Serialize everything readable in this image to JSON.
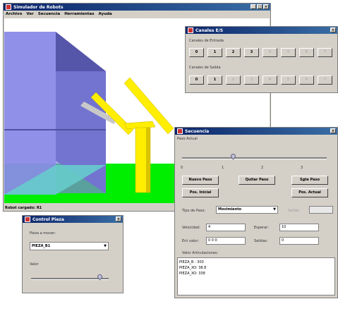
{
  "main_window": {
    "title": "Simulador de Robots",
    "menu": [
      "Archivo",
      "Ver",
      "Secuencia",
      "Herramientas",
      "Ayuda"
    ],
    "status": "Robot cargado: R1",
    "title_buttons": [
      "_",
      "□",
      "×"
    ]
  },
  "canales": {
    "title": "Canales E/S",
    "input_label": "Canales de Entrada",
    "output_label": "Canales de Salida",
    "input_buttons": [
      "0",
      "1",
      "2",
      "3",
      "4",
      "5",
      "6",
      "7"
    ],
    "input_enabled_count": 4,
    "output_buttons": [
      "0",
      "1",
      "2",
      "3",
      "4",
      "5",
      "6",
      "7"
    ],
    "output_enabled_count": 2
  },
  "secuencia": {
    "title": "Secuencia",
    "step_label": "Paso Actual",
    "slider_ticks": [
      "0",
      "1",
      "2",
      "3"
    ],
    "slider_value": 0.35,
    "buttons": {
      "new_step": "Nuevo Paso",
      "delete_step": "Quitar Paso",
      "next_step": "Sgte Paso",
      "initial_pos": "Pos. Inicial",
      "current_pos": "Pos. Actual"
    },
    "type_label": "Tipo de Paso:",
    "type_value": "Movimiento",
    "salida_label": "Salida:",
    "salida_value": "",
    "velocidad_label": "Velocidad:",
    "velocidad_value": "4",
    "espera_label": "Esperar:",
    "espera_value": "10",
    "entrada_label": "Ent valor:",
    "entrada_value": "0 0 0",
    "salidas_label": "Salidas:",
    "salidas_value": "0",
    "list_label": "Valor Articulaciones:",
    "list_items": [
      "PIEZA_B : 303",
      "PIEZA_XO: 38.8",
      "PIEZA_XO: 338"
    ]
  },
  "control": {
    "title": "Control Pieza",
    "pieza_label": "Pieza a mover:",
    "pieza_value": "PIEZA_B1",
    "valor_label": "Valor",
    "slider_value": 0.88
  },
  "colors": {
    "titlebar": "#0a246a",
    "panel": "#d4d0c8",
    "floor": "#00ee00",
    "box": "#8888ee",
    "robot": "#ffee00"
  }
}
